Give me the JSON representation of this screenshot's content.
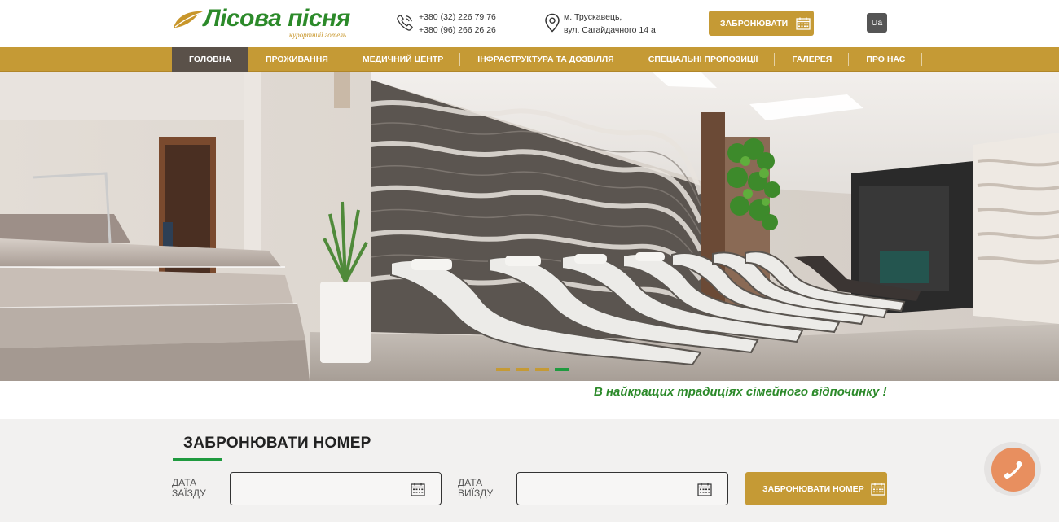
{
  "header": {
    "logo_title": "Лісова пісня",
    "logo_subtitle": "курортний готель",
    "phones": [
      "+380 (32) 226 79 76",
      "+380 (96) 266 26 26"
    ],
    "address": [
      "м. Трускавець,",
      "вул. Сагайдачного 14 а"
    ],
    "book_label": "ЗАБРОНЮВАТИ",
    "lang_label": "Ua"
  },
  "nav": {
    "items": [
      {
        "label": "ГОЛОВНА",
        "active": true
      },
      {
        "label": "ПРОЖИВАННЯ"
      },
      {
        "label": "МЕДИЧНИЙ ЦЕНТР"
      },
      {
        "label": "ІНФРАСТРУКТУРА ТА ДОЗВІЛЛЯ"
      },
      {
        "label": "СПЕЦІАЛЬНІ ПРОПОЗИЦІЇ"
      },
      {
        "label": "ГАЛЕРЕЯ"
      },
      {
        "label": "ПРО НАС"
      }
    ]
  },
  "hero": {
    "slide_count": 4,
    "active_slide": 4
  },
  "slogan": "В найкращих традиціях сімейного відпочинку !",
  "booking": {
    "title": "ЗАБРОНЮВАТИ НОМЕР",
    "checkin_label_1": "ДАТА",
    "checkin_label_2": "ЗАЇЗДУ",
    "checkin_value": "",
    "checkout_label_1": "ДАТА",
    "checkout_label_2": "ВИЇЗДУ",
    "checkout_value": "",
    "submit_label": "ЗАБРОНЮВАТИ НОМЕР"
  },
  "colors": {
    "gold": "#c59a35",
    "green": "#2c8a2a",
    "accent_green": "#1f9a3f",
    "nav_active": "#5a5149",
    "call_button": "#e88f5f"
  },
  "icons": {
    "logo": "leaf-icon",
    "phone": "phone-icon",
    "address": "map-pin-icon",
    "calendar": "calendar-icon",
    "call": "call-icon"
  }
}
